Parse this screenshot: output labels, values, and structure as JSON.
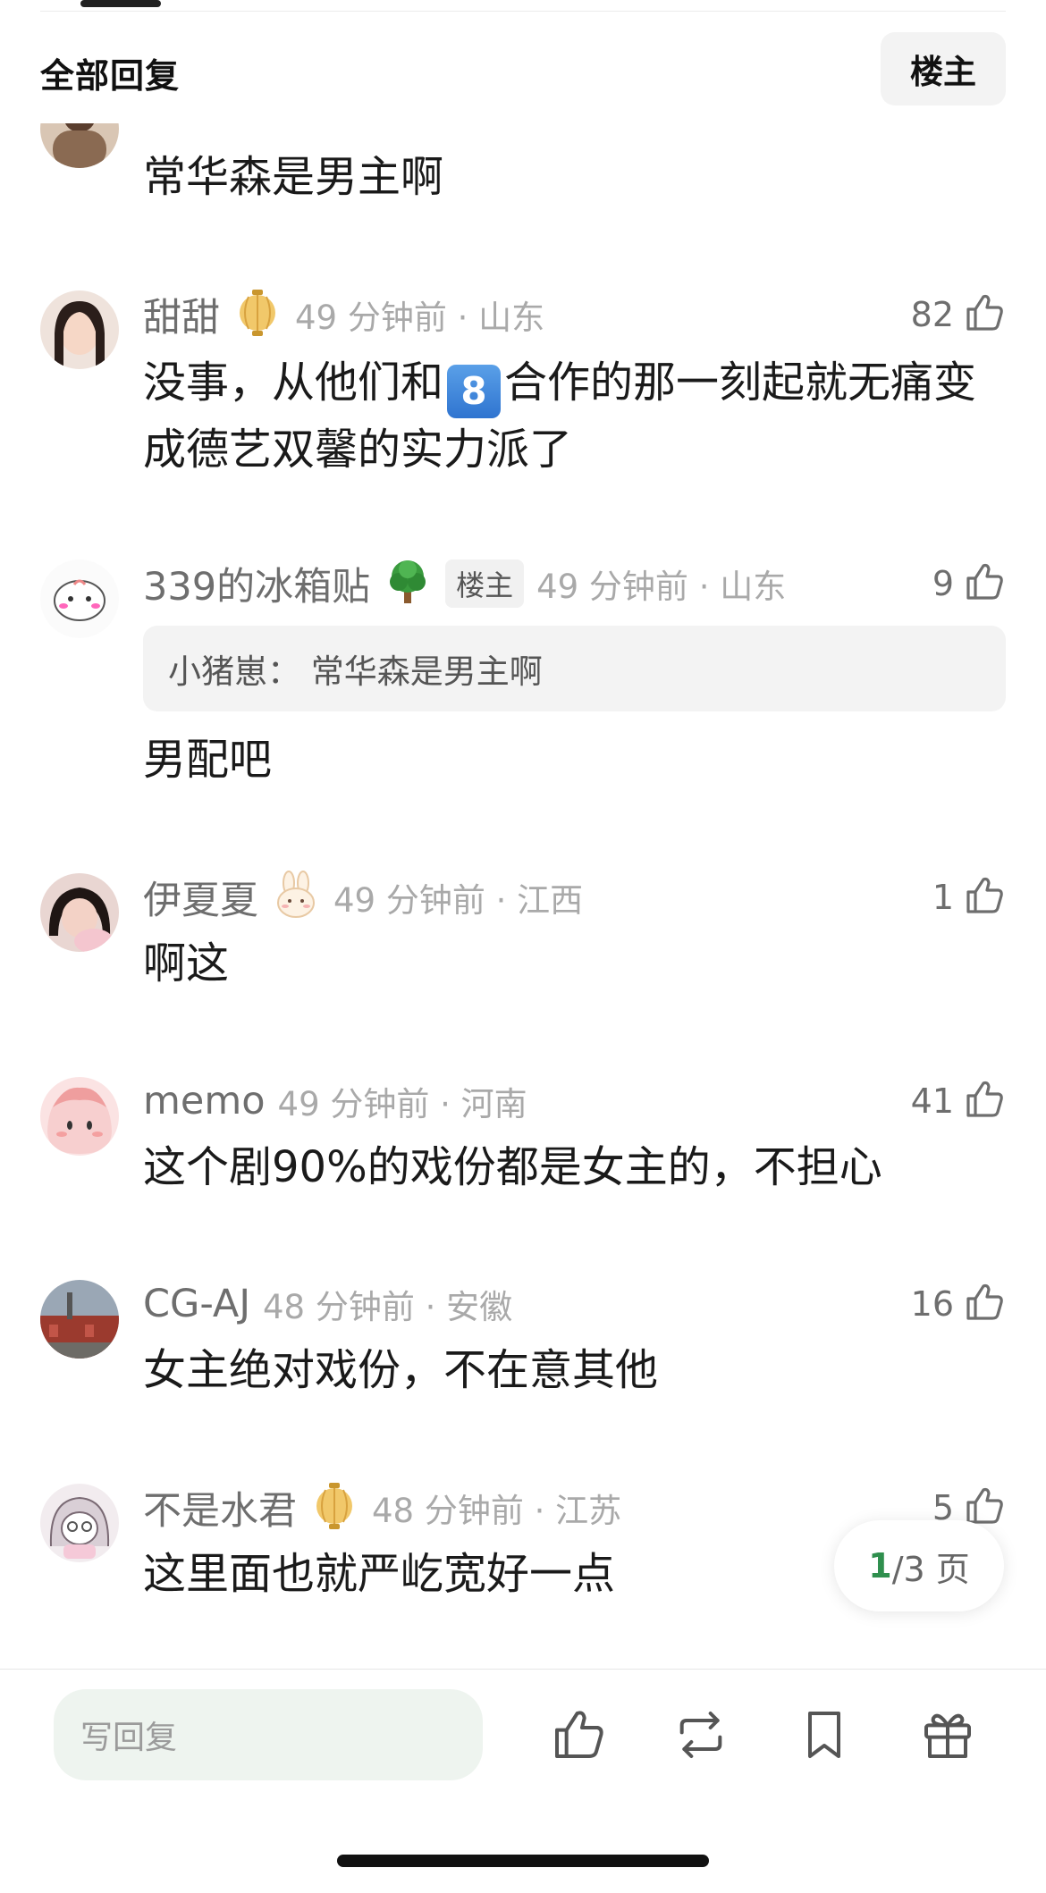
{
  "header": {
    "title": "全部回复",
    "op_filter": "楼主"
  },
  "comments": [
    {
      "username": "",
      "meta": "",
      "likes": "",
      "content": "常华森是男主啊",
      "avatar_color": "#7a5c48"
    },
    {
      "username": "甜甜",
      "meta": "49 分钟前 · 山东",
      "likes": "82",
      "content_pre": "没事，从他们和",
      "emoji": "8",
      "content_post": "合作的那一刻起就无痛变成德艺双馨的实力派了"
    },
    {
      "username": "339的冰箱贴",
      "op_tag": "楼主",
      "meta": "49 分钟前 · 山东",
      "likes": "9",
      "quote": "小猪崽：   常华森是男主啊",
      "content": "男配吧"
    },
    {
      "username": "伊夏夏",
      "meta": "49 分钟前 · 江西",
      "likes": "1",
      "content": "啊这"
    },
    {
      "username": "memo",
      "meta": "49 分钟前 · 河南",
      "likes": "41",
      "content": "这个剧90%的戏份都是女主的，不担心"
    },
    {
      "username": "CG-AJ",
      "meta": "48 分钟前 · 安徽",
      "likes": "16",
      "content": "女主绝对戏份，不在意其他"
    },
    {
      "username": "不是水君",
      "meta": "48 分钟前 · 江苏",
      "likes": "5",
      "content": "这里面也就严屹宽好一点"
    }
  ],
  "pagination": {
    "current": "1",
    "rest": "/3 页"
  },
  "bottom_bar": {
    "reply_placeholder": "写回复",
    "icons": [
      "thumb-up-icon",
      "repost-icon",
      "bookmark-icon",
      "gift-icon"
    ]
  },
  "colors": {
    "accent_green": "#2f8f4e",
    "text_muted": "#a9a9a9"
  }
}
